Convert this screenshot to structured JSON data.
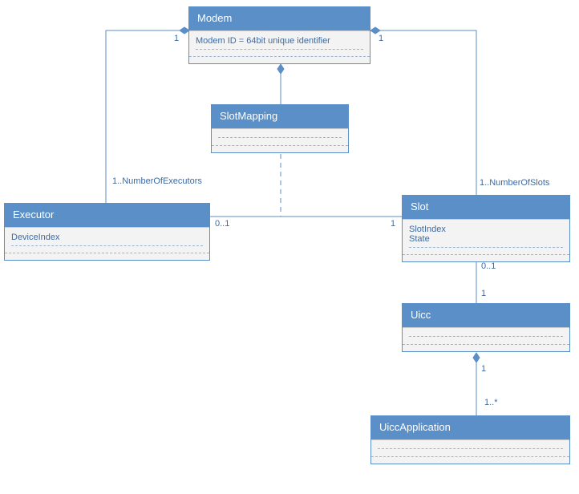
{
  "classes": {
    "modem": {
      "name": "Modem",
      "attr1": "Modem ID = 64bit unique identifier"
    },
    "slotmapping": {
      "name": "SlotMapping"
    },
    "executor": {
      "name": "Executor",
      "attr1": "DeviceIndex"
    },
    "slot": {
      "name": "Slot",
      "attr1": "SlotIndex",
      "attr2": "State"
    },
    "uicc": {
      "name": "Uicc"
    },
    "uiccapp": {
      "name": "UiccApplication"
    }
  },
  "labels": {
    "one_a": "1",
    "one_b": "1",
    "num_executors": "1..NumberOfExecutors",
    "num_slots": "1..NumberOfSlots",
    "zero_one": "0..1",
    "one_c": "1",
    "zero_one_b": "0..1",
    "one_d": "1",
    "one_e": "1",
    "one_star": "1..*"
  }
}
